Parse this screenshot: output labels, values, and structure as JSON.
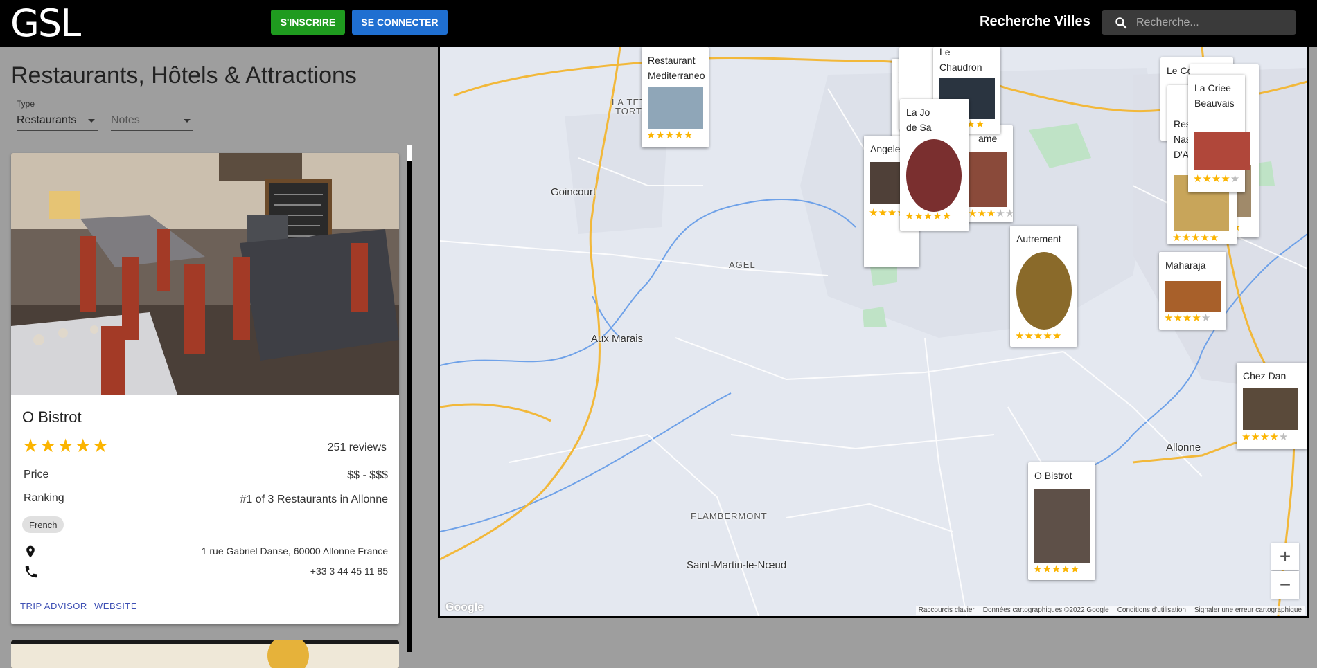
{
  "header": {
    "logo": "GSL",
    "signup_label": "S'INSCRIRE",
    "login_label": "SE CONNECTER",
    "city_search_title": "Recherche Villes",
    "search_placeholder": "Recherche..."
  },
  "filters": {
    "page_title": "Restaurants, Hôtels & Attractions",
    "type_label": "Type",
    "type_value": "Restaurants",
    "notes_placeholder": "Notes"
  },
  "card": {
    "name": "O Bistrot",
    "rating": 5,
    "reviews": "251 reviews",
    "price_label": "Price",
    "price_value": "$$ - $$$",
    "ranking_label": "Ranking",
    "ranking_value": "#1 of 3 Restaurants in Allonne",
    "cuisine": "French",
    "address": "1 rue Gabriel Danse, 60000 Allonne France",
    "phone": "+33 3 44 45 11 85",
    "link_tripadvisor": "TRIP ADVISOR",
    "link_website": "WEBSITE"
  },
  "map": {
    "places": {
      "goincourt": "Goincourt",
      "aux_marais": "Aux Marais",
      "flambermont": "FLAMBERMONT",
      "saint_martin": "Saint-Martin-le-Nœud",
      "allonne": "Allonne",
      "agel": "AGEL",
      "la_tete": "LA TETE",
      "tort": "TORT"
    },
    "markers": [
      {
        "name_line1": "Restaurant",
        "name_line2": "Mediterraneo",
        "rating": 5
      },
      {
        "name_line1": "Le",
        "name_line2": "Chaudron",
        "rating": 5
      },
      {
        "name_line1": "La Jo",
        "name_line2": "de Sa",
        "rating": 5
      },
      {
        "name_line1": "Angele",
        "name_line2": "",
        "rating": 5
      },
      {
        "name_line1": "ame",
        "name_line2": "",
        "rating": 3
      },
      {
        "name_line1": "Sa",
        "name_line2": "",
        "rating": 5
      },
      {
        "name_line1": "Le Comptoir",
        "name_line2": "",
        "rating": 5
      },
      {
        "name_line1": "Res",
        "name_line2": "Nas",
        "name_line3": "D'A",
        "rating": 5
      },
      {
        "name_line1": "La Criee",
        "name_line2": "Beauvais",
        "rating": 4
      },
      {
        "name_line1": "Autrement",
        "name_line2": "",
        "rating": 5
      },
      {
        "name_line1": "Maharaja",
        "name_line2": "",
        "rating": 4
      },
      {
        "name_line1": "Chez Dan",
        "name_line2": "",
        "rating": 4
      },
      {
        "name_line1": "O Bistrot",
        "name_line2": "",
        "rating": 5
      }
    ],
    "zoom_in": "+",
    "zoom_out": "−",
    "google_logo": "Google",
    "attribution": {
      "shortcuts": "Raccourcis clavier",
      "data": "Données cartographiques ©2022 Google",
      "terms": "Conditions d'utilisation",
      "report": "Signaler une erreur cartographique"
    }
  },
  "colors": {
    "signup_bg": "#1f9b1f",
    "login_bg": "#1f6fd1",
    "star": "#fbb400",
    "link": "#3f51b5"
  }
}
